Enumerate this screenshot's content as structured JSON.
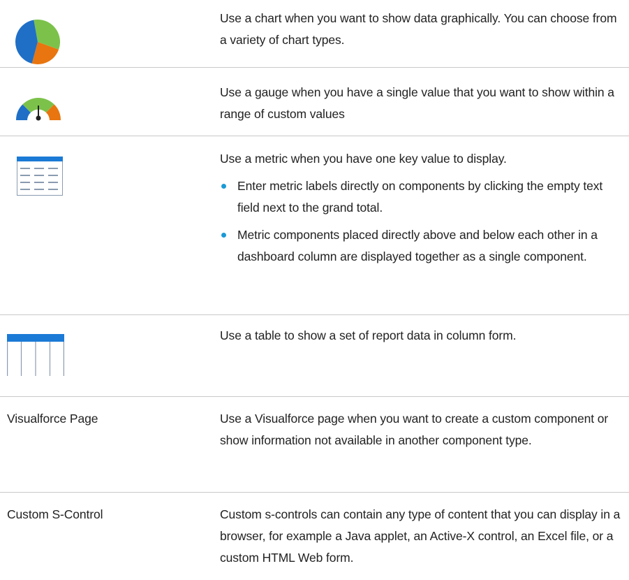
{
  "rows": [
    {
      "icon": "pie-chart-icon",
      "description": "Use a chart when you want to show data graphically. You can choose from a variety of chart types."
    },
    {
      "icon": "gauge-icon",
      "description": "Use a gauge when you have a single value that you want to show within a range of custom values"
    },
    {
      "icon": "metric-icon",
      "description": "Use a metric when you have one key value to display.",
      "bullets": [
        "Enter metric labels directly on components by clicking the empty text field next to the grand total.",
        "Metric components placed directly above and below each other in a dashboard column are displayed together as a single component."
      ]
    },
    {
      "icon": "table-icon",
      "description": "Use a table to show a set of report data in column form."
    },
    {
      "label": "Visualforce Page",
      "description": "Use a Visualforce page when you want to create a custom component or show information not available in another component type."
    },
    {
      "label": "Custom S-Control",
      "description": "Custom s-controls can contain any type of content that you can display in a browser, for example a Java applet, an Active-X control, an Excel file, or a custom HTML Web form."
    }
  ],
  "colors": {
    "pie_blue": "#1f6fc7",
    "pie_green": "#7cc24a",
    "pie_orange": "#e8750f",
    "table_header_blue": "#1b7ad6",
    "bullet": "#1a9ad6",
    "divider": "#c9c9c9"
  }
}
